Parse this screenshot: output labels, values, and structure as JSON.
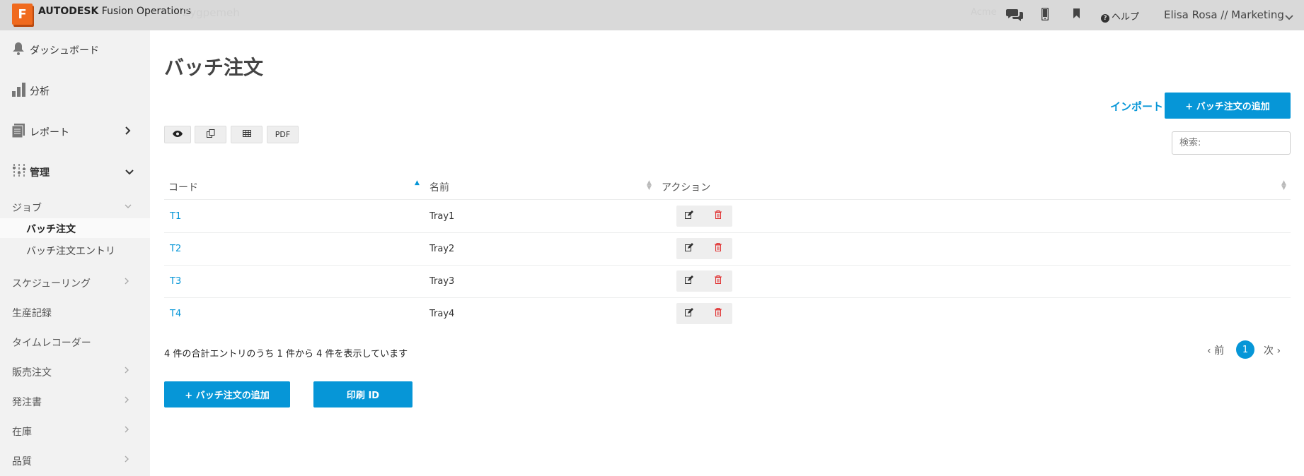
{
  "app": {
    "logo_letter": "F",
    "brand_bold": "AUTODESK",
    "brand_rest": " Fusion Operations",
    "ghost_title": "Zygpemeh",
    "ghost_right": "Acme"
  },
  "topbar": {
    "icons": [
      "chat-icon",
      "mobile-icon",
      "bookmark-icon"
    ],
    "help_label": "ヘルプ",
    "user_label": "Elisa Rosa // Marketing"
  },
  "sidebar": {
    "top_items": [
      {
        "label": "ダッシュボード",
        "icon": "bell-icon"
      },
      {
        "label": "分析",
        "icon": "bar-chart-icon"
      },
      {
        "label": "レポート",
        "icon": "document-icon"
      },
      {
        "label": "管理",
        "icon": "sliders-icon"
      }
    ],
    "jobs_label": "ジョブ",
    "children": [
      "バッチ注文",
      "バッチ注文エントリ"
    ],
    "sub_items": [
      "スケジューリング",
      "生産記録",
      "タイムレコーダー",
      "販売注文",
      "発注書",
      "在庫",
      "品質"
    ]
  },
  "main": {
    "title": "バッチ注文",
    "import_label": "インポート",
    "add_label": "+ バッチ注文の追加",
    "search_placeholder": "検索:",
    "tools": [
      "eye-icon",
      "copy-icon",
      "table-icon"
    ],
    "pdf_label": "PDF",
    "columns": [
      "コード",
      "名前",
      "アクション"
    ],
    "rows": [
      {
        "code": "T1",
        "name": "Tray1"
      },
      {
        "code": "T2",
        "name": "Tray2"
      },
      {
        "code": "T3",
        "name": "Tray3"
      },
      {
        "code": "T4",
        "name": "Tray4"
      }
    ],
    "info_text": "4 件の合計エントリのうち 1 件から 4 件を表示しています",
    "prev_label": "前",
    "page_number": "1",
    "next_label": "次",
    "bottom_add_label": "+ バッチ注文の追加",
    "print_label": "印刷 ID"
  },
  "colors": {
    "accent": "#0696d7",
    "brand": "#f06a1e",
    "danger": "#e03131"
  }
}
